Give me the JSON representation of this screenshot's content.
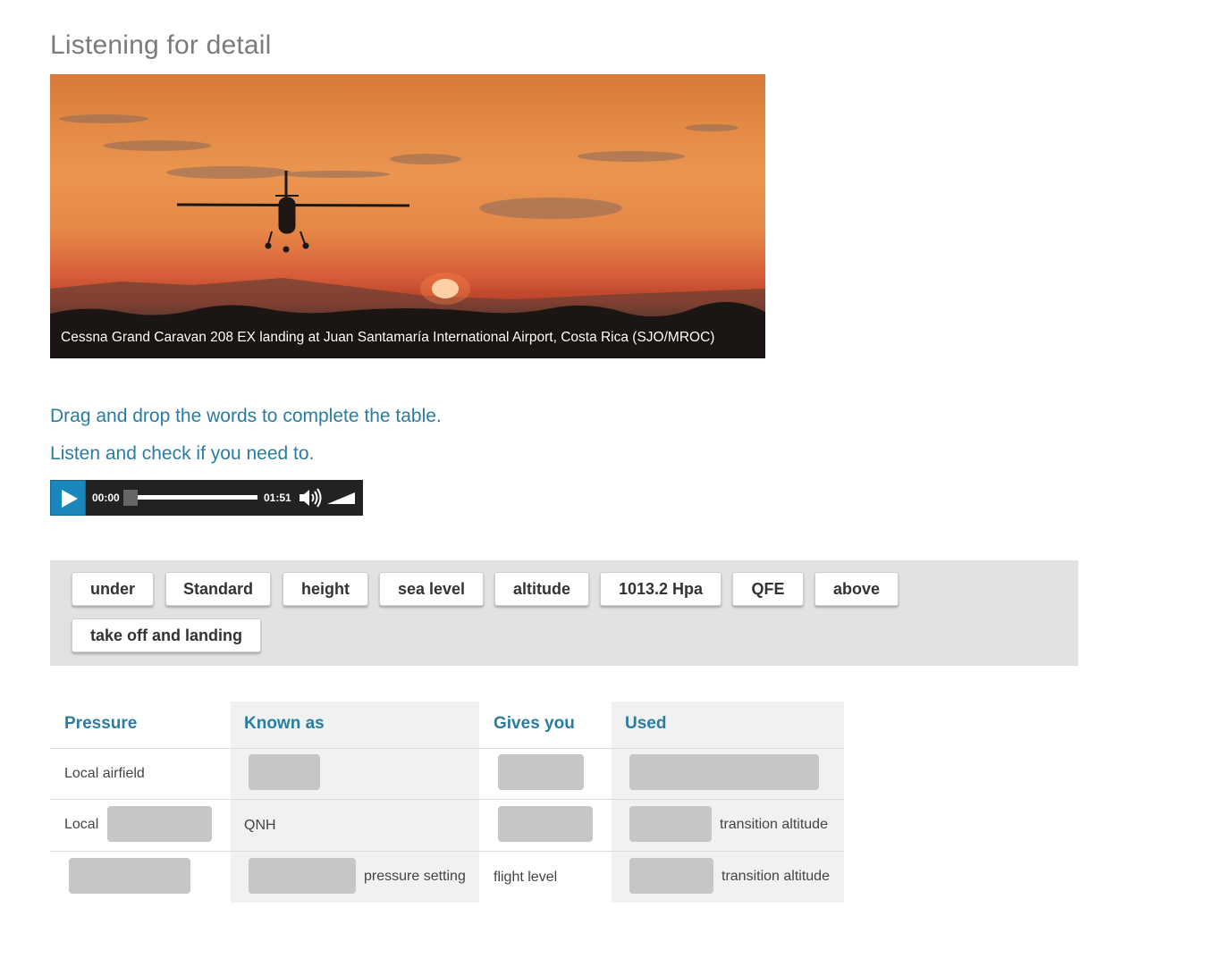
{
  "page": {
    "title": "Listening for detail"
  },
  "image": {
    "caption": "Cessna Grand Caravan 208 EX landing at Juan Santamaría International Airport, Costa Rica (SJO/MROC)"
  },
  "instructions": {
    "line1": "Drag and drop the words to complete the table.",
    "line2": "Listen and check if you need to."
  },
  "audio": {
    "current_time": "00:00",
    "duration": "01:51",
    "progress": 0,
    "accent_color": "#1b86b9"
  },
  "word_bank": {
    "words": [
      "under",
      "Standard",
      "height",
      "sea level",
      "altitude",
      "1013.2 Hpa",
      "QFE",
      "above",
      "take off and landing"
    ]
  },
  "table": {
    "headers": [
      "Pressure",
      "Known as",
      "Gives you",
      "Used"
    ],
    "rows": [
      {
        "pressure": "Local airfield",
        "known_as": "",
        "gives_you": "",
        "used": ""
      },
      {
        "pressure": "Local",
        "known_as": "QNH",
        "gives_you": "",
        "used": "transition altitude"
      },
      {
        "pressure": "",
        "known_as": "pressure setting",
        "gives_you": "flight level",
        "used": "transition altitude"
      }
    ],
    "header_color": "#2a7da0"
  }
}
